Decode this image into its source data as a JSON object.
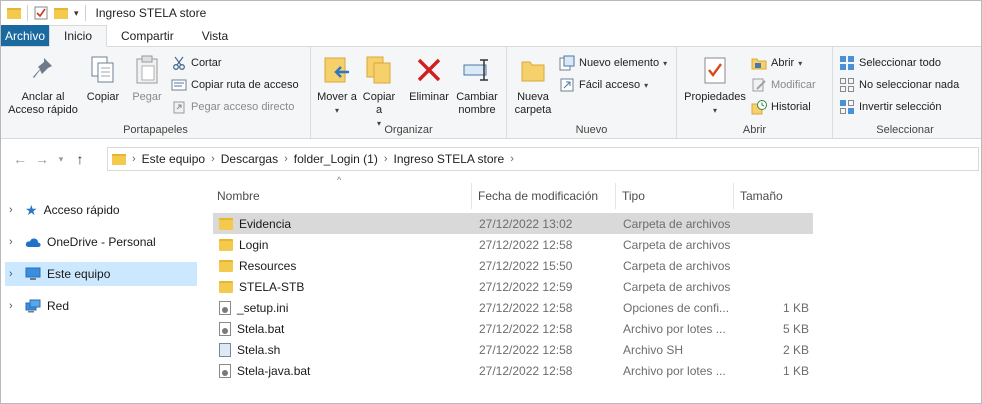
{
  "window": {
    "title": "Ingreso STELA store"
  },
  "tabs": [
    {
      "label": "Archivo"
    },
    {
      "label": "Inicio"
    },
    {
      "label": "Compartir"
    },
    {
      "label": "Vista"
    }
  ],
  "ribbon": {
    "portapapeles": {
      "label": "Portapapeles",
      "anclar": "Anclar al Acceso rápido",
      "copiar": "Copiar",
      "pegar": "Pegar",
      "cortar": "Cortar",
      "copiar_ruta": "Copiar ruta de acceso",
      "pegar_acceso": "Pegar acceso directo"
    },
    "organizar": {
      "label": "Organizar",
      "mover": "Mover a",
      "copiar": "Copiar a",
      "eliminar": "Eliminar",
      "cambiar": "Cambiar nombre"
    },
    "nuevo": {
      "label": "Nuevo",
      "nueva_carpeta": "Nueva carpeta",
      "nuevo_elemento": "Nuevo elemento",
      "facil_acceso": "Fácil acceso"
    },
    "abrir": {
      "label": "Abrir",
      "propiedades": "Propiedades",
      "abrir": "Abrir",
      "modificar": "Modificar",
      "historial": "Historial"
    },
    "seleccionar": {
      "label": "Seleccionar",
      "todo": "Seleccionar todo",
      "nada": "No seleccionar nada",
      "invertir": "Invertir selección"
    }
  },
  "breadcrumb": [
    "Este equipo",
    "Descargas",
    "folder_Login (1)",
    "Ingreso STELA store"
  ],
  "navpane": [
    {
      "label": "Acceso rápido",
      "icon": "star-icon"
    },
    {
      "label": "OneDrive - Personal",
      "icon": "cloud-icon"
    },
    {
      "label": "Este equipo",
      "icon": "computer-icon",
      "selected": true
    },
    {
      "label": "Red",
      "icon": "network-icon"
    }
  ],
  "columns": {
    "name": "Nombre",
    "date": "Fecha de modificación",
    "type": "Tipo",
    "size": "Tamaño"
  },
  "files": [
    {
      "name": "Evidencia",
      "date": "27/12/2022 13:02",
      "type": "Carpeta de archivos",
      "size": "",
      "kind": "folder",
      "selected": true
    },
    {
      "name": "Login",
      "date": "27/12/2022 12:58",
      "type": "Carpeta de archivos",
      "size": "",
      "kind": "folder"
    },
    {
      "name": "Resources",
      "date": "27/12/2022 15:50",
      "type": "Carpeta de archivos",
      "size": "",
      "kind": "folder"
    },
    {
      "name": "STELA-STB",
      "date": "27/12/2022 12:59",
      "type": "Carpeta de archivos",
      "size": "",
      "kind": "folder"
    },
    {
      "name": "_setup.ini",
      "date": "27/12/2022 12:58",
      "type": "Opciones de confi...",
      "size": "1 KB",
      "kind": "ini"
    },
    {
      "name": "Stela.bat",
      "date": "27/12/2022 12:58",
      "type": "Archivo por lotes ...",
      "size": "5 KB",
      "kind": "bat"
    },
    {
      "name": "Stela.sh",
      "date": "27/12/2022 12:58",
      "type": "Archivo SH",
      "size": "2 KB",
      "kind": "sh"
    },
    {
      "name": "Stela-java.bat",
      "date": "27/12/2022 12:58",
      "type": "Archivo por lotes ...",
      "size": "1 KB",
      "kind": "bat"
    }
  ]
}
